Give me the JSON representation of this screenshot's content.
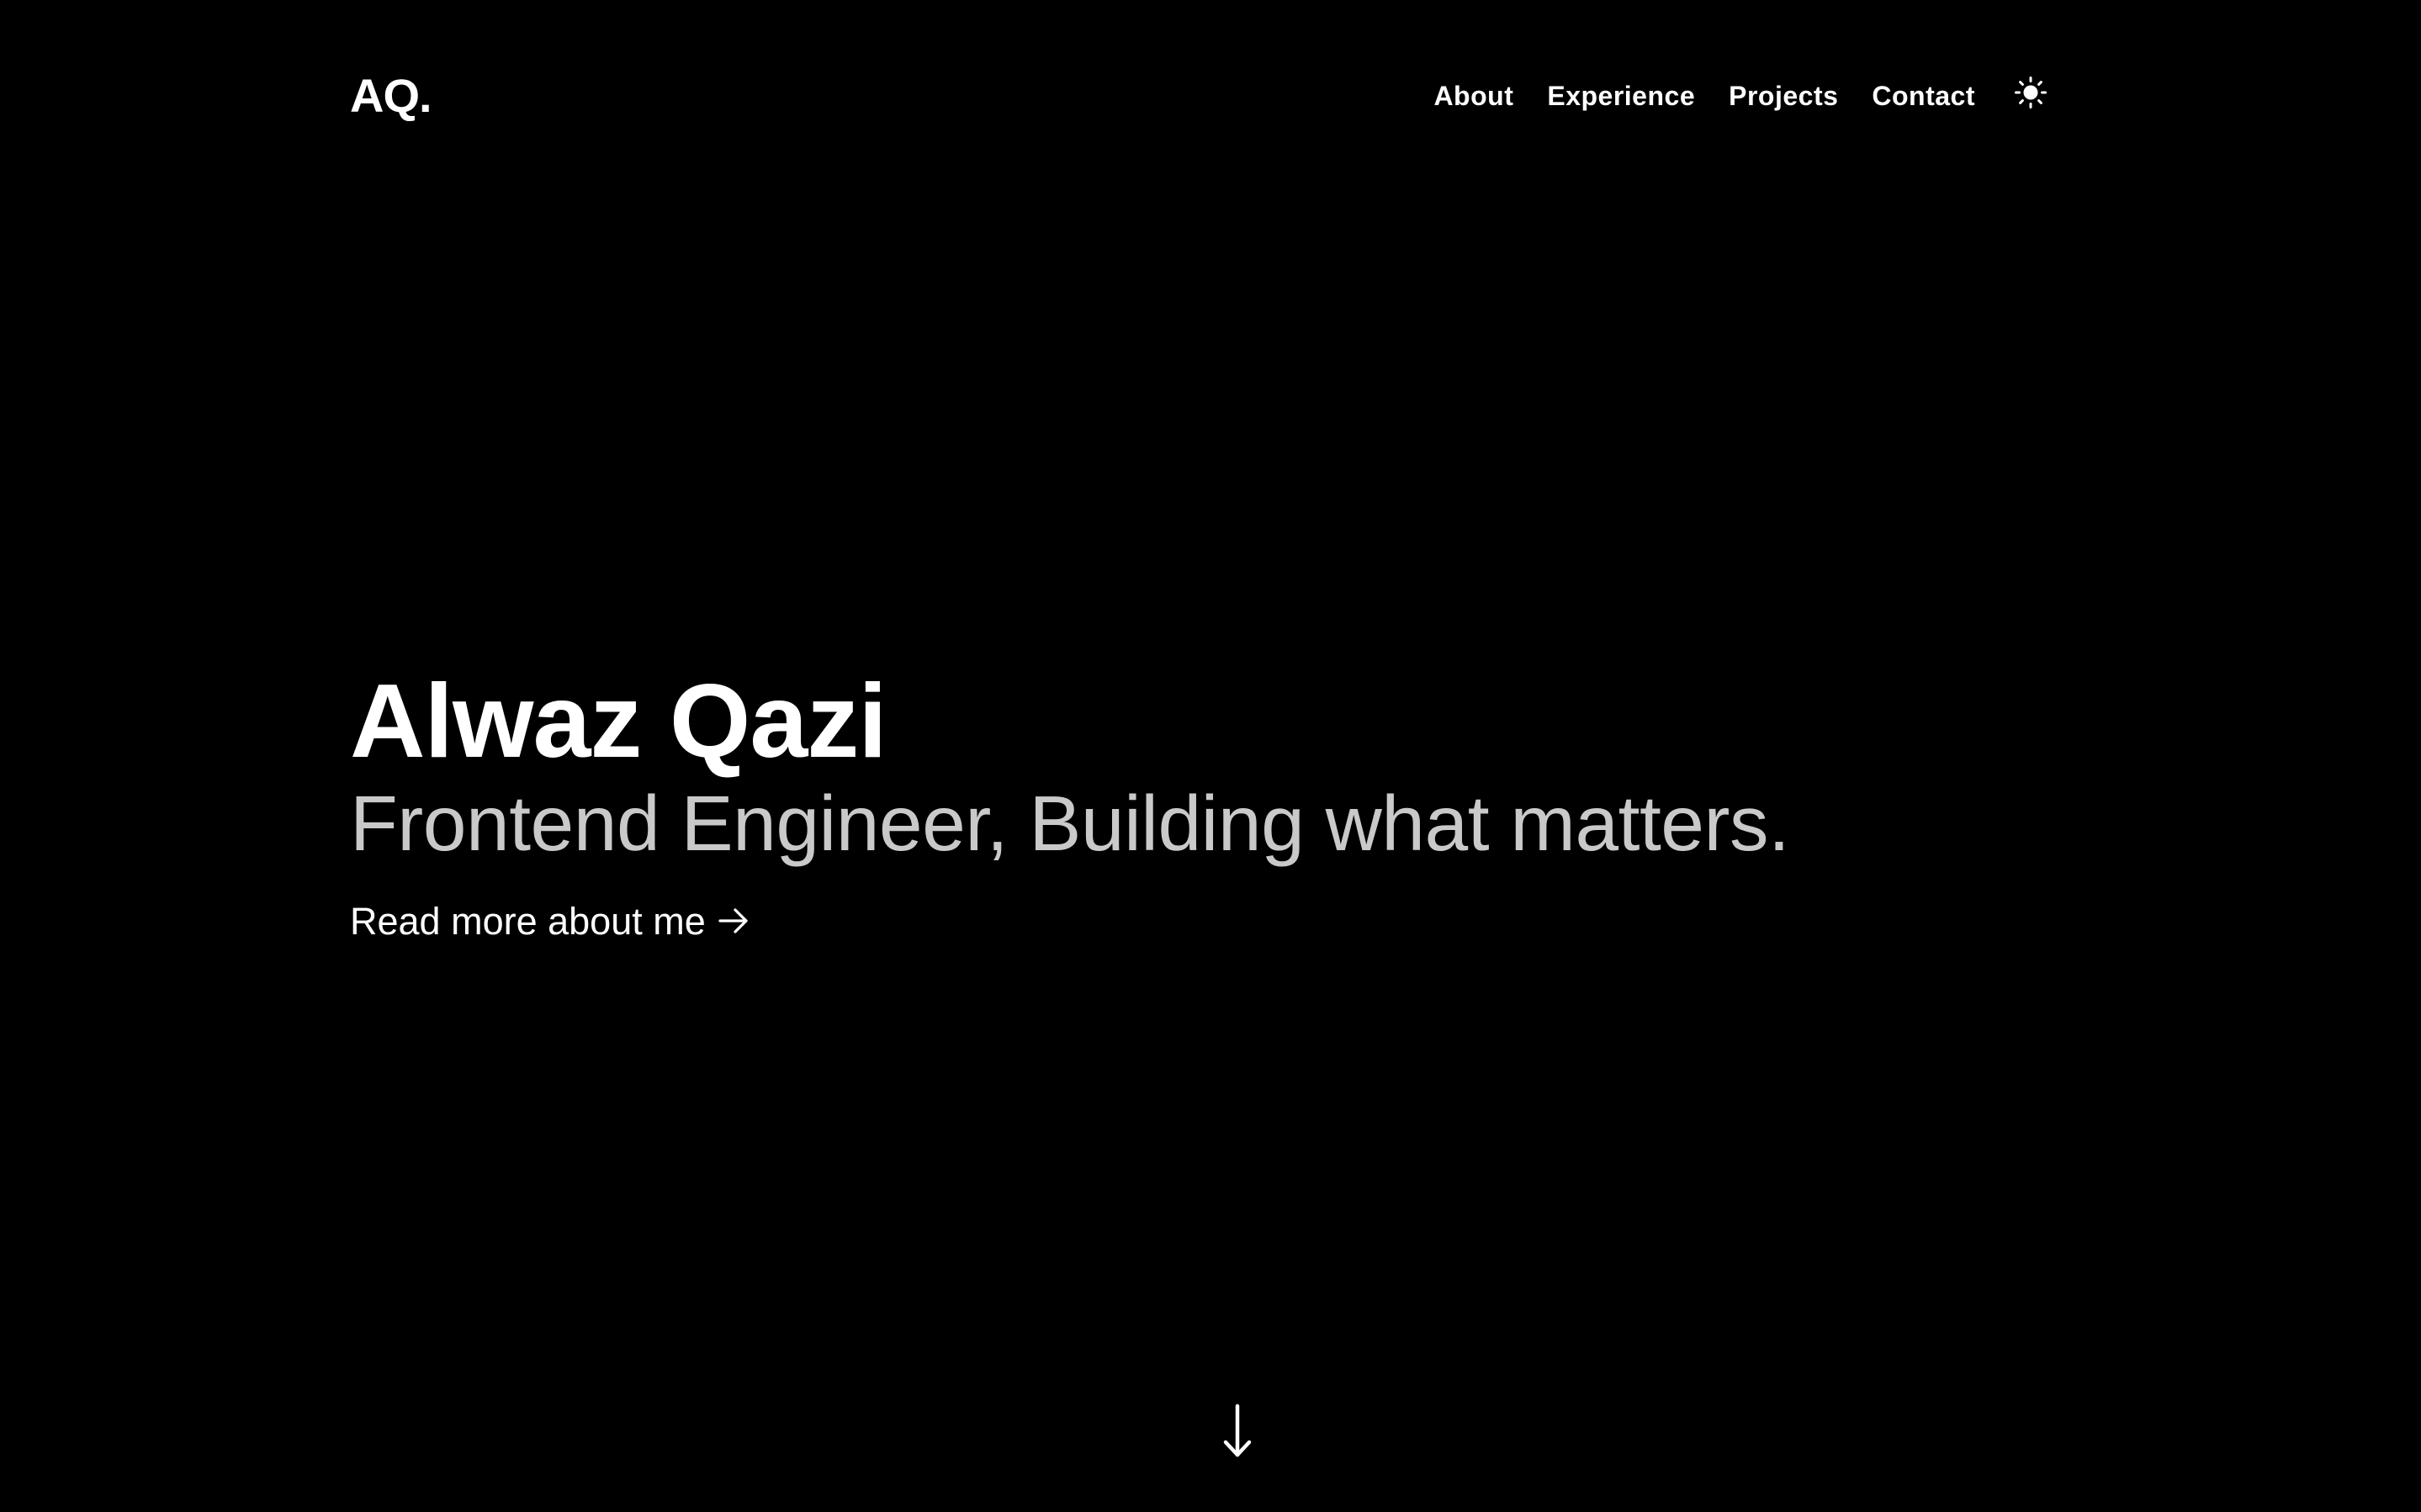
{
  "header": {
    "logo": "AQ.",
    "nav": [
      {
        "label": "About"
      },
      {
        "label": "Experience"
      },
      {
        "label": "Projects"
      },
      {
        "label": "Contact"
      }
    ],
    "theme_toggle_icon": "sun-icon"
  },
  "hero": {
    "name": "Alwaz Qazi",
    "tagline": "Frontend Engineer, Building what matters.",
    "cta_label": "Read more about me",
    "cta_icon": "arrow-right-icon"
  },
  "scroll_indicator_icon": "arrow-down-icon",
  "colors": {
    "background": "#000000",
    "text": "#ffffff",
    "tagline": "#c9c9c9"
  }
}
